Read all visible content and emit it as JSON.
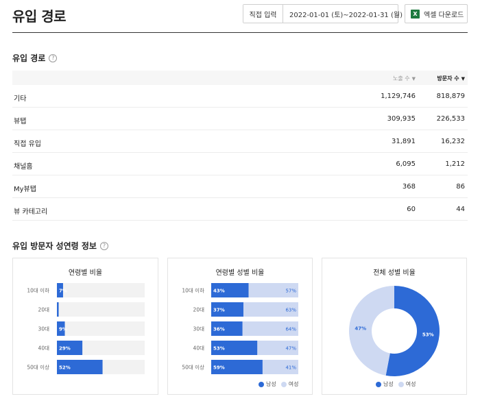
{
  "header": {
    "title": "유입 경로",
    "direct_input_label": "직접 입력",
    "date_range": "2022-01-01 (토)~2022-01-31 (월)",
    "excel_label": "엑셀 다운로드",
    "excel_icon_text": "X"
  },
  "help_text": "?",
  "sort_caret": "▼",
  "inflow": {
    "title": "유입 경로",
    "columns": [
      "노출 수",
      "방문자 수"
    ],
    "rows": [
      {
        "name": "기타",
        "impressions": "1,129,746",
        "visitors": "818,879"
      },
      {
        "name": "뷰탭",
        "impressions": "309,935",
        "visitors": "226,533"
      },
      {
        "name": "직접 유입",
        "impressions": "31,891",
        "visitors": "16,232"
      },
      {
        "name": "채널홈",
        "impressions": "6,095",
        "visitors": "1,212"
      },
      {
        "name": "My뷰탭",
        "impressions": "368",
        "visitors": "86"
      },
      {
        "name": "뷰 카테고리",
        "impressions": "60",
        "visitors": "44"
      }
    ]
  },
  "demographics": {
    "title": "유입 방문자 성연령 정보",
    "legend": {
      "male": "남성",
      "female": "여성"
    }
  },
  "colors": {
    "male": "#2d6ad6",
    "female": "#ced9f2",
    "track": "#f2f2f2"
  },
  "chart_data": [
    {
      "type": "bar",
      "orientation": "horizontal",
      "title": "연령별 비율",
      "categories": [
        "10대 이하",
        "20대",
        "30대",
        "40대",
        "50대 이상"
      ],
      "values": [
        7,
        2,
        9,
        29,
        52
      ],
      "labels": [
        "7%",
        "",
        "9%",
        "29%",
        "52%"
      ],
      "xlim": [
        0,
        100
      ]
    },
    {
      "type": "bar",
      "orientation": "horizontal",
      "stacked": true,
      "title": "연령별 성별 비율",
      "categories": [
        "10대 이하",
        "20대",
        "30대",
        "40대",
        "50대 이상"
      ],
      "series": [
        {
          "name": "남성",
          "values": [
            43,
            37,
            36,
            53,
            59
          ]
        },
        {
          "name": "여성",
          "values": [
            57,
            63,
            64,
            47,
            41
          ]
        }
      ],
      "xlim": [
        0,
        100
      ]
    },
    {
      "type": "pie",
      "donut": true,
      "title": "전체 성별 비율",
      "categories": [
        "남성",
        "여성"
      ],
      "values": [
        53,
        47
      ]
    }
  ]
}
